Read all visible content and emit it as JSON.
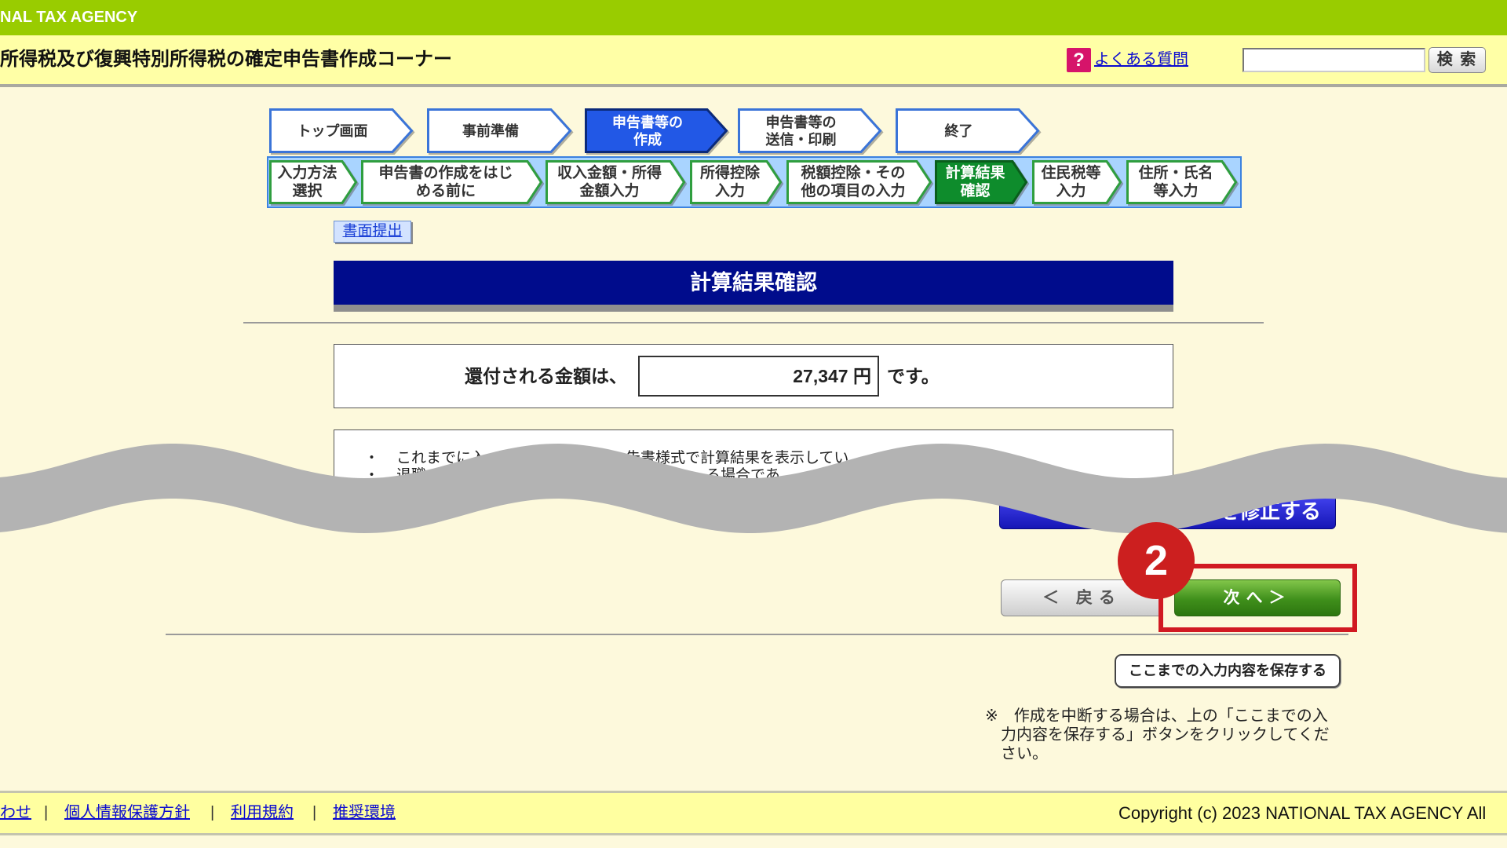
{
  "banner": {
    "text": "NAL TAX AGENCY"
  },
  "header": {
    "title": "所得税及び復興特別所得税の確定申告書作成コーナー",
    "help_icon": "?",
    "help_icon_name": "question-icon",
    "faq_link": "よくある質問",
    "search_value": "",
    "search_button": "検 索"
  },
  "nav": {
    "steps": [
      {
        "lines": [
          "トップ画面"
        ],
        "active": false
      },
      {
        "lines": [
          "事前準備"
        ],
        "active": false
      },
      {
        "lines": [
          "申告書等の",
          "作成"
        ],
        "active": true
      },
      {
        "lines": [
          "申告書等の",
          "送信・印刷"
        ],
        "active": false
      },
      {
        "lines": [
          "終了"
        ],
        "active": false
      }
    ],
    "substeps": [
      {
        "lines": [
          "入力方法",
          "選択"
        ],
        "active": false
      },
      {
        "lines": [
          "申告書の作成をはじ",
          "める前に"
        ],
        "active": false
      },
      {
        "lines": [
          "収入金額・所得",
          "金額入力"
        ],
        "active": false
      },
      {
        "lines": [
          "所得控除",
          "入力"
        ],
        "active": false
      },
      {
        "lines": [
          "税額控除・その",
          "他の項目の入力"
        ],
        "active": false
      },
      {
        "lines": [
          "計算結果",
          "確認"
        ],
        "active": true
      },
      {
        "lines": [
          "住民税等",
          "入力"
        ],
        "active": false
      },
      {
        "lines": [
          "住所・氏名",
          "等入力"
        ],
        "active": false
      }
    ]
  },
  "submission_method": "書面提出",
  "section_title": "計算結果確認",
  "refund": {
    "prefix": "還付される金額は、",
    "amount": "27,347 円",
    "suffix": "です。"
  },
  "notes": {
    "bullet": "・",
    "line1": [
      "これまでに入",
      "告書様式で計算結果を表示してい"
    ],
    "line2": [
      "退職",
      "る場合であ"
    ]
  },
  "modify_button": "を修正する",
  "buttons": {
    "back": "＜ 戻る",
    "next": "次へ＞",
    "save": "ここまでの入力内容を保存する"
  },
  "save_note": "※　作成を中断する場合は、上の「ここまでの入力内容を保存する」ボタンをクリックしてください。",
  "callout": {
    "number": "2"
  },
  "footer": {
    "links": [
      "わせ",
      "個人情報保護方針",
      "利用規約",
      "推奨環境"
    ],
    "separator": "|",
    "copyright": "Copyright (c) 2023 NATIONAL TAX AGENCY All"
  },
  "colors": {
    "banner": "#99cc00",
    "header_bg": "#ffffa6",
    "title_bar": "#000c8c",
    "active_step_top": "#2258e6",
    "active_step_sub": "#0e8c2c",
    "next_button": "#3f8f1b",
    "highlight": "#d11a22"
  }
}
